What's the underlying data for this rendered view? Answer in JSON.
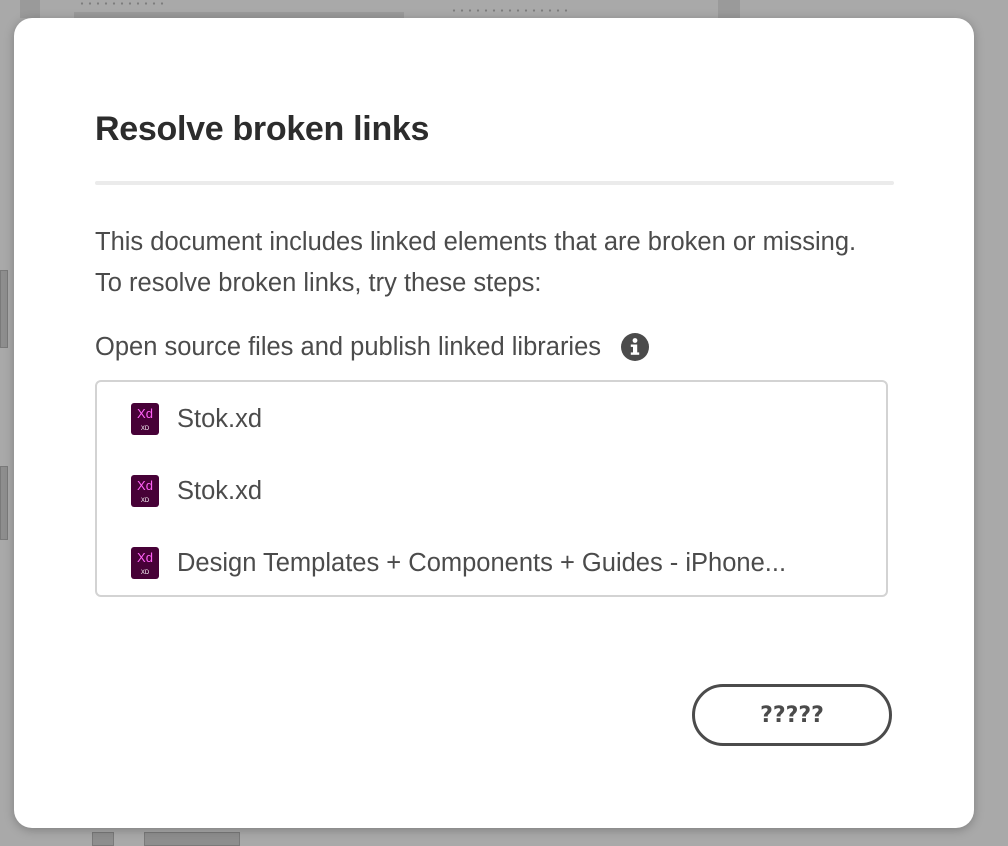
{
  "dialog": {
    "title": "Resolve broken links",
    "description": "This document includes linked elements that are broken or missing. To resolve broken links, try these steps:",
    "section_label": "Open source files and publish linked libraries",
    "info_icon": "info-circle-icon",
    "files": [
      {
        "name": "Stok.xd",
        "icon": "xd-file-icon"
      },
      {
        "name": "Stok.xd",
        "icon": "xd-file-icon"
      },
      {
        "name": "Design Templates + Components + Guides - iPhone...",
        "icon": "xd-file-icon"
      }
    ],
    "ok_button_label": "?????"
  },
  "colors": {
    "xd_icon_bg": "#470137",
    "xd_icon_text": "#ff61f6",
    "text": "#4b4b4b",
    "title": "#2c2c2c"
  }
}
